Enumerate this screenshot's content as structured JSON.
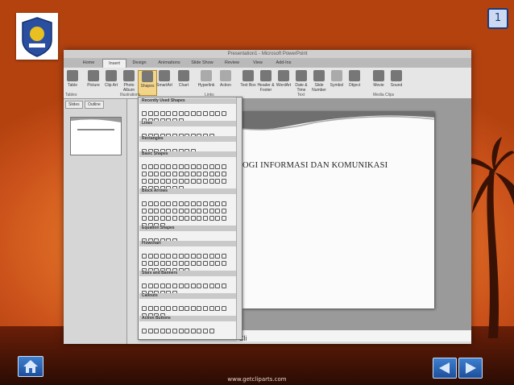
{
  "slide_number": "1",
  "footer_text": "www.getcliparts.com",
  "screenshot": {
    "window_title": "Presentation1 - Microsoft PowerPoint",
    "tabs": [
      "Home",
      "Insert",
      "Design",
      "Animations",
      "Slide Show",
      "Review",
      "View",
      "Add-Ins"
    ],
    "active_tab": "Insert",
    "ribbon_buttons": [
      "Table",
      "Picture",
      "Clip Art",
      "Photo Album",
      "Shapes",
      "SmartArt",
      "Chart",
      "Hyperlink",
      "Action",
      "Text Box",
      "Header & Footer",
      "WordArt",
      "Date & Time",
      "Slide Number",
      "Symbol",
      "Object",
      "Movie",
      "Sound"
    ],
    "ribbon_groups": [
      "Tables",
      "Illustrations",
      "Links",
      "Text",
      "Media Clips"
    ],
    "left_tabs": [
      "Slides",
      "Outline"
    ],
    "slide_title": "OGI INFORMASI DAN KOMUNIKASI",
    "notes_placeholder": "Cli",
    "shape_categories": [
      "Recently Used Shapes",
      "Lines",
      "Rectangles",
      "Basic Shapes",
      "Block Arrows",
      "Equation Shapes",
      "Flowchart",
      "Stars and Banners",
      "Callouts",
      "Action Buttons"
    ]
  },
  "colors": {
    "sky_orange": "#e8782a",
    "nav_button_blue": "#2a63b5",
    "slide_number_border": "#1b3a7a"
  },
  "icons": [
    "school-logo-icon",
    "home-icon",
    "arrow-left-icon",
    "arrow-right-icon"
  ]
}
